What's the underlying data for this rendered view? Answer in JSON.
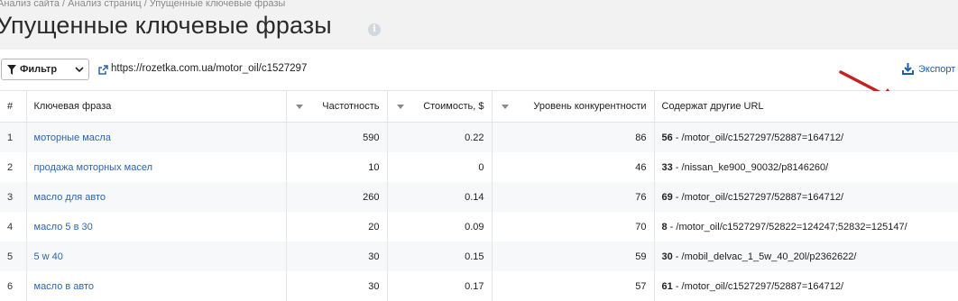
{
  "breadcrumb": "Анализ сайта / Анализ страниц / Упущенные ключевые фразы",
  "page_title": "Упущенные ключевые фразы",
  "toolbar": {
    "filter_label": "Фильтр",
    "url": "https://rozetka.com.ua/motor_oil/c1527297",
    "export_label": "Экспорт"
  },
  "colors": {
    "link": "#2f64ad",
    "export": "#1e5fa8",
    "annotation_arrow": "#c8201e",
    "header_band": "#f2f2f2"
  },
  "icons": {
    "filter": "funnel-icon",
    "dropdown": "chevron-down-icon",
    "url": "external-link-icon",
    "export": "download-icon",
    "title_info": "info-icon"
  },
  "table": {
    "columns": {
      "index": "#",
      "phrase": "Ключевая фраза",
      "frequency": "Частотность",
      "cost": "Стоимость, $",
      "competition": "Уровень конкурентности",
      "other_urls": "Содержат другие URL"
    },
    "rows": [
      {
        "index": "1",
        "phrase": "моторные масла",
        "frequency": "590",
        "cost": "0.22",
        "competition": "86",
        "url_count": "56",
        "url_path": " - /motor_oil/c1527297/52887=164712/"
      },
      {
        "index": "2",
        "phrase": "продажа моторных масел",
        "frequency": "10",
        "cost": "0",
        "competition": "46",
        "url_count": "33",
        "url_path": " - /nissan_ke900_90032/p8146260/"
      },
      {
        "index": "3",
        "phrase": "масло для авто",
        "frequency": "260",
        "cost": "0.14",
        "competition": "76",
        "url_count": "69",
        "url_path": " - /motor_oil/c1527297/52887=164712/"
      },
      {
        "index": "4",
        "phrase": "масло 5 в 30",
        "frequency": "20",
        "cost": "0.09",
        "competition": "70",
        "url_count": "8",
        "url_path": " - /motor_oil/c1527297/52822=124247;52832=125147/"
      },
      {
        "index": "5",
        "phrase": "5 w 40",
        "frequency": "30",
        "cost": "0.15",
        "competition": "59",
        "url_count": "30",
        "url_path": " - /mobil_delvac_1_5w_40_20l/p2362622/"
      },
      {
        "index": "6",
        "phrase": "масло в авто",
        "frequency": "30",
        "cost": "0.17",
        "competition": "57",
        "url_count": "61",
        "url_path": " - /motor_oil/c1527297/52887=164712/"
      }
    ]
  }
}
